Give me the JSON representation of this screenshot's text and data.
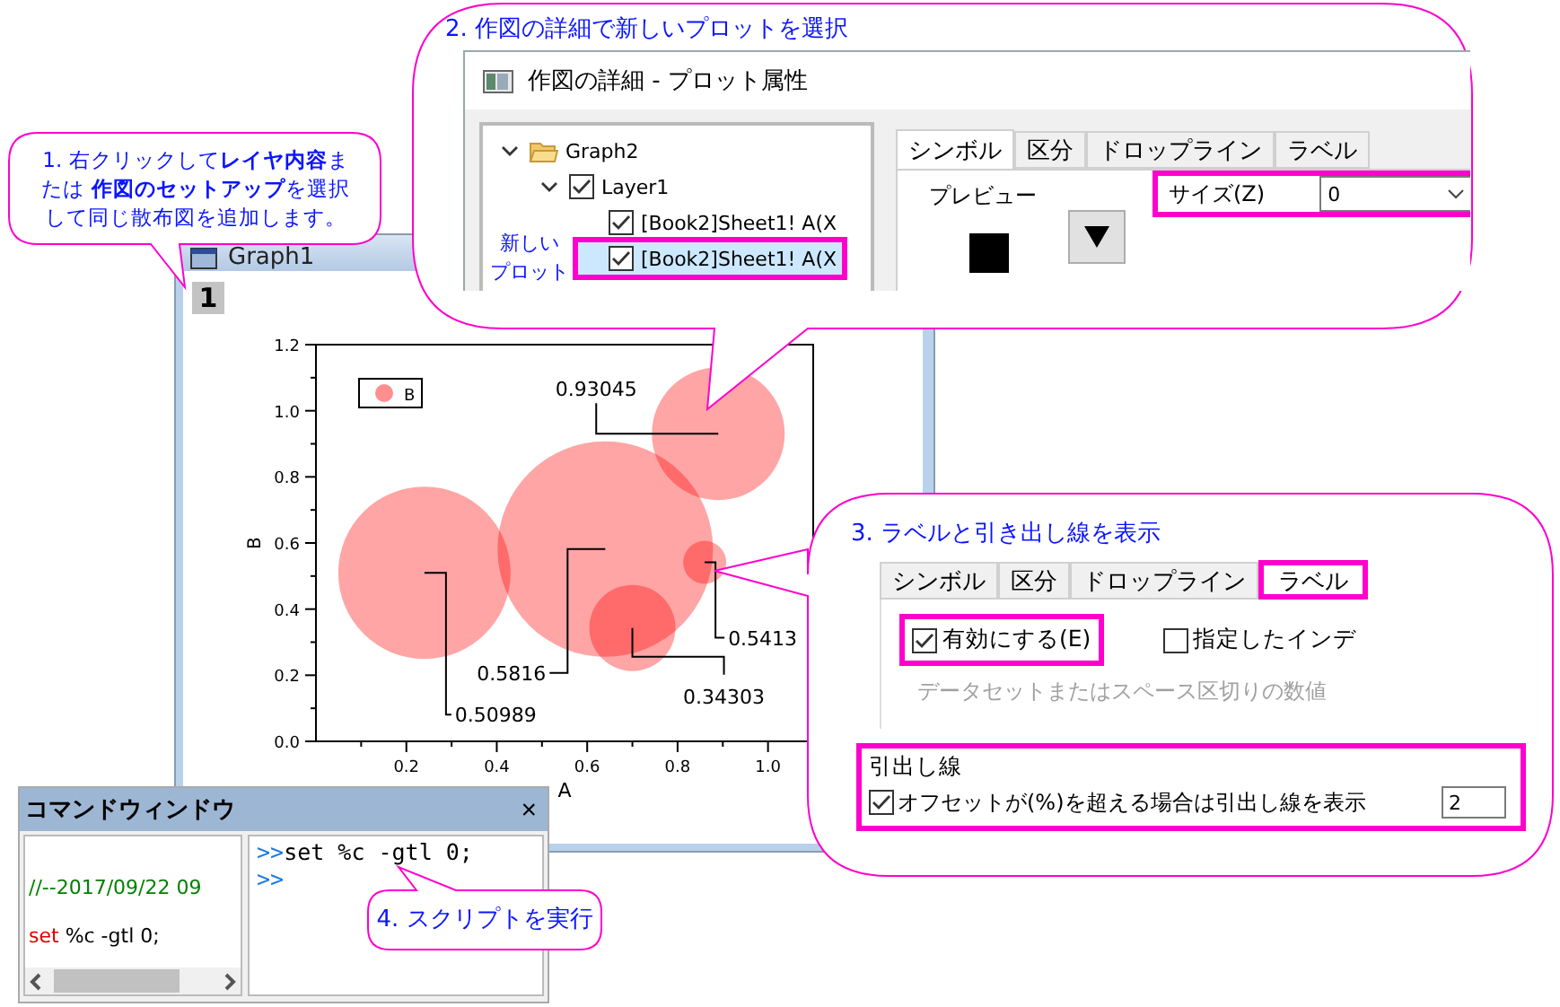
{
  "graph_window": {
    "title": "Graph1",
    "layer": "1",
    "chart_data": {
      "type": "scatter",
      "xlabel": "A",
      "ylabel": "B",
      "x": [
        0.24,
        0.64,
        0.89,
        0.7,
        0.86
      ],
      "series": [
        {
          "name": "B",
          "color": "#ff8f8f",
          "values": [
            0.50989,
            0.5816,
            0.93045,
            0.34303,
            0.5413
          ],
          "sizes": [
            0.64,
            1.0,
            0.38,
            0.16,
            0.04
          ]
        }
      ],
      "xlim": [
        0,
        1.1
      ],
      "ylim": [
        0,
        1.2
      ],
      "xticks": [
        {
          "value": 0.2,
          "label": "0.2"
        },
        {
          "value": 0.4,
          "label": "0.4"
        },
        {
          "value": 0.6,
          "label": "0.6"
        },
        {
          "value": 0.8,
          "label": "0.8"
        },
        {
          "value": 1,
          "label": "1.0"
        }
      ],
      "yticks": [
        {
          "value": 0,
          "label": "0.0"
        },
        {
          "value": 0.2,
          "label": "0.2"
        },
        {
          "value": 0.4,
          "label": "0.4"
        },
        {
          "value": 0.6,
          "label": "0.6"
        },
        {
          "value": 0.8,
          "label": "0.8"
        },
        {
          "value": 1,
          "label": "1.0"
        },
        {
          "value": 1.2,
          "label": "1.2"
        }
      ],
      "data_labels": true
    }
  },
  "step1": {
    "text": "1. 右クリックして**レイヤ内容**または **作図のセットアップ**を選択して同じ散布図を追加します。"
  },
  "step2": {
    "title": "2. 作図の詳細で新しいプロットを選択",
    "dialog": {
      "title": "作図の詳細 - プロット属性",
      "tree": [
        {
          "label": "Graph2",
          "expanded": true,
          "children": [
            {
              "label": "Layer1",
              "checked": true,
              "expanded": true,
              "children": [
                {
                  "label": "[Book2]Sheet1!  A(X",
                  "checked": true,
                  "selected": false,
                  "highlighted": false
                },
                {
                  "label": "[Book2]Sheet1!  A(X",
                  "checked": true,
                  "selected": true,
                  "highlighted": true
                }
              ]
            }
          ]
        }
      ],
      "note_lines": [
        "新しい",
        "プロット"
      ],
      "tabs": [
        {
          "label": "シンボル",
          "selected": true
        },
        {
          "label": "区分",
          "selected": false
        },
        {
          "label": "ドロップライン",
          "selected": false
        },
        {
          "label": "ラベル",
          "selected": false
        }
      ],
      "preview_label": "プレビュー",
      "size_label": "サイズ(Z)",
      "size_value": "0",
      "size_highlighted": true
    }
  },
  "step3": {
    "title": "3. ラベルと引き出し線を表示",
    "tabs": [
      {
        "label": "シンボル",
        "selected": false,
        "highlighted": false
      },
      {
        "label": "区分",
        "selected": false,
        "highlighted": false
      },
      {
        "label": "ドロップライン",
        "selected": false,
        "highlighted": false
      },
      {
        "label": "ラベル",
        "selected": true,
        "highlighted": true
      }
    ],
    "options": [
      {
        "label": "有効にする(E)",
        "checked": true,
        "highlighted": true
      },
      {
        "label": "指定したインデ",
        "checked": false,
        "highlighted": false
      }
    ],
    "hint": "データセットまたはスペース区切りの数値",
    "leader_group": {
      "title": "引出し線",
      "highlighted": true,
      "label": "オフセットが(%)を超える場合は引出し線を表示",
      "checked": true,
      "value": "2"
    }
  },
  "command_window": {
    "title": "コマンドウィンドウ",
    "close": "×",
    "history": [
      {
        "kind": "comment",
        "text": "//--2017/09/22 09"
      },
      {
        "kind": "command",
        "keyword": "set",
        "text": "%c -gtl 0;"
      }
    ],
    "console": [
      {
        "prompt": ">>",
        "text": "set %c -gtl 0;"
      },
      {
        "prompt": ">>"
      }
    ]
  },
  "step4": {
    "text": "4. スクリプトを実行"
  }
}
